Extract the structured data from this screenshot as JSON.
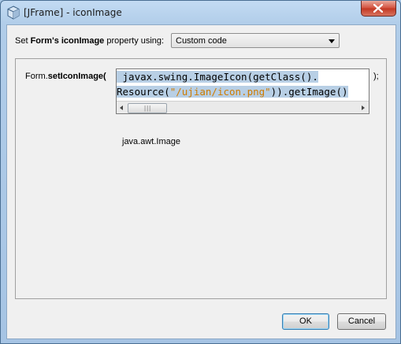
{
  "window": {
    "title": "[JFrame] - iconImage"
  },
  "property_row": {
    "prefix": "Set ",
    "form_name": "Form's",
    "property_name": "iconImage",
    "suffix": " property using:",
    "mode_selected": "Custom code"
  },
  "editor": {
    "prefix_object": "Form.",
    "method": "setIconImage",
    "open_paren": "(",
    "close_paren": ");",
    "code_line1": " javax.swing.ImageIcon(getClass().",
    "code_line2_pre": "Resource(",
    "code_line2_str": "\"/ujian/icon.png\"",
    "code_line2_post": ")).getImage()",
    "scroll_grip": "|||",
    "return_type": "java.awt.Image"
  },
  "buttons": {
    "ok": "OK",
    "cancel": "Cancel"
  },
  "colors": {
    "selection": "#b8cfe5",
    "string_literal": "#ce7b00",
    "close_button": "#c9442f"
  }
}
